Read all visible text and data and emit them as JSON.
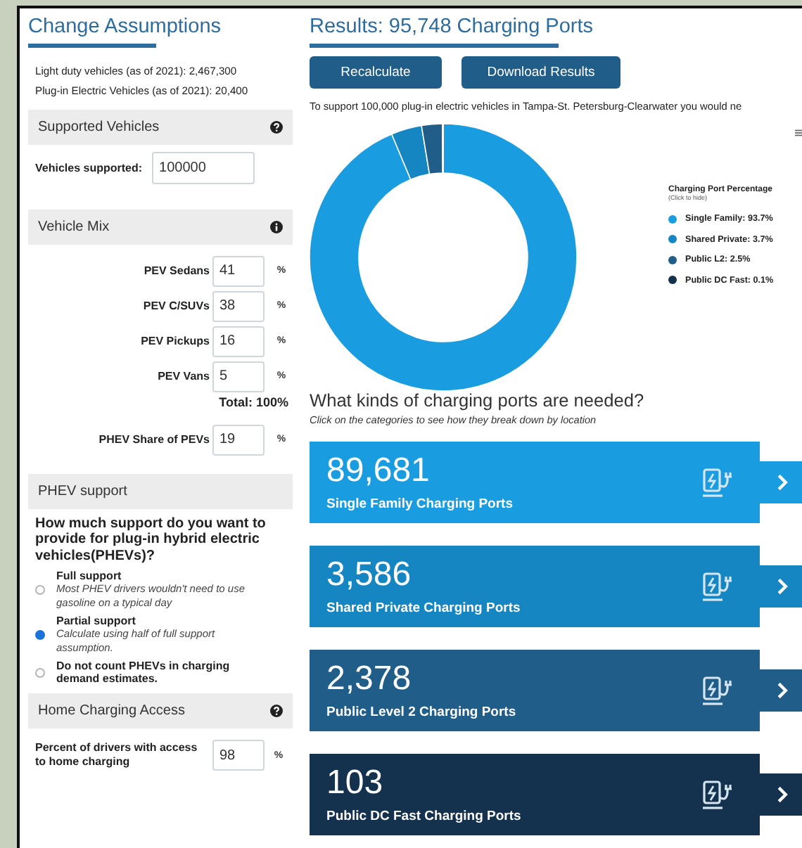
{
  "assumptions": {
    "title": "Change Assumptions",
    "info": [
      "Light duty vehicles (as of 2021): 2,467,300",
      "Plug-in Electric Vehicles (as of 2021): 20,400"
    ],
    "supported_vehicles": {
      "header": "Supported Vehicles",
      "label": "Vehicles supported:",
      "value": "100000"
    },
    "vehicle_mix": {
      "header": "Vehicle Mix",
      "rows": [
        {
          "label": "PEV Sedans",
          "value": "41",
          "unit": "%"
        },
        {
          "label": "PEV C/SUVs",
          "value": "38",
          "unit": "%"
        },
        {
          "label": "PEV Pickups",
          "value": "16",
          "unit": "%"
        },
        {
          "label": "PEV Vans",
          "value": "5",
          "unit": "%"
        }
      ],
      "total": "Total: 100%",
      "phev_share": {
        "label": "PHEV Share of PEVs",
        "value": "19",
        "unit": "%"
      }
    },
    "phev_support": {
      "header": "PHEV support",
      "question": "How much support do you want to provide for plug-in hybrid electric vehicles(PHEVs)?",
      "options": [
        {
          "label": "Full support",
          "description": "Most PHEV drivers wouldn't need to use gasoline on a typical day",
          "selected": false
        },
        {
          "label": "Partial support",
          "description": "Calculate using half of full support assumption.",
          "selected": true
        },
        {
          "label": "Do not count PHEVs in charging demand estimates.",
          "selected": false
        }
      ]
    },
    "home_charging": {
      "header": "Home Charging Access",
      "label": "Percent of drivers with access to home charging",
      "value": "98",
      "unit": "%"
    }
  },
  "results": {
    "title": "Results: 95,748 Charging Ports",
    "buttons": [
      "Recalculate",
      "Download Results"
    ],
    "summary": "To support 100,000 plug-in electric vehicles in Tampa-St. Petersburg-Clearwater you would ne",
    "chart_data": {
      "type": "donut",
      "title": "Charging Port Percentage",
      "values": [
        93.7,
        3.7,
        2.5,
        0.1
      ]
    },
    "legend": {
      "subtitle": "(Click to hide)",
      "items": [
        {
          "label": "Single Family: 93.7%",
          "color": "#1a9de0"
        },
        {
          "label": "Shared Private: 3.7%",
          "color": "#1686c2"
        },
        {
          "label": "Public L2: 2.5%",
          "color": "#215d89"
        },
        {
          "label": "Public DC Fast: 0.1%",
          "color": "#14324d"
        }
      ]
    },
    "ports_heading": "What kinds of charging ports are needed?",
    "ports_subheading": "Click on the categories to see how they break down by location",
    "port_cards": [
      {
        "count": "89,681",
        "label": "Single Family Charging Ports",
        "color": "#1a9de0"
      },
      {
        "count": "3,586",
        "label": "Shared Private Charging Ports",
        "color": "#1686c2"
      },
      {
        "count": "2,378",
        "label": "Public Level 2 Charging Ports",
        "color": "#215d89"
      },
      {
        "count": "103",
        "label": "Public DC Fast Charging Ports",
        "color": "#14324d"
      }
    ]
  }
}
